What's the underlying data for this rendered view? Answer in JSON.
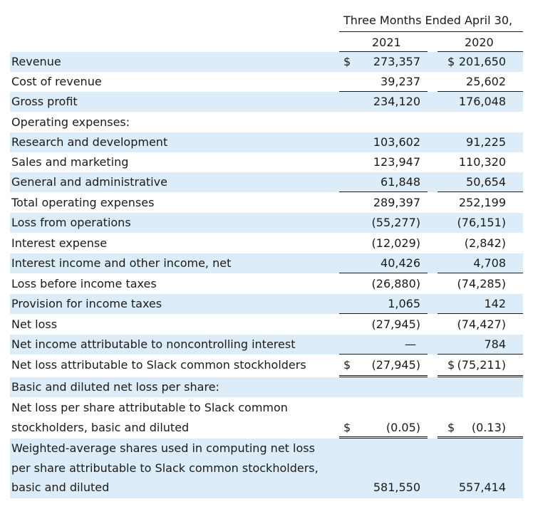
{
  "header": {
    "period": "Three Months Ended April 30,",
    "col1": "2021",
    "col2": "2020"
  },
  "rows": [
    {
      "label": "Revenue",
      "cur1": "$",
      "v1": "273,357",
      "cur2": "$",
      "v2": "201,650"
    },
    {
      "label": "Cost of revenue",
      "cur1": "",
      "v1": "39,237",
      "cur2": "",
      "v2": "25,602"
    },
    {
      "label": "Gross profit",
      "cur1": "",
      "v1": "234,120",
      "cur2": "",
      "v2": "176,048"
    },
    {
      "label": "Operating expenses:",
      "cur1": "",
      "v1": "",
      "cur2": "",
      "v2": ""
    },
    {
      "label": "Research and development",
      "cur1": "",
      "v1": "103,602",
      "cur2": "",
      "v2": "91,225"
    },
    {
      "label": "Sales and marketing",
      "cur1": "",
      "v1": "123,947",
      "cur2": "",
      "v2": "110,320"
    },
    {
      "label": "General and administrative",
      "cur1": "",
      "v1": "61,848",
      "cur2": "",
      "v2": "50,654"
    },
    {
      "label": "Total operating expenses",
      "cur1": "",
      "v1": "289,397",
      "cur2": "",
      "v2": "252,199"
    },
    {
      "label": "Loss from operations",
      "cur1": "",
      "v1": "(55,277)",
      "cur2": "",
      "v2": "(76,151)"
    },
    {
      "label": "Interest expense",
      "cur1": "",
      "v1": "(12,029)",
      "cur2": "",
      "v2": "(2,842)"
    },
    {
      "label": "Interest income and other income, net",
      "cur1": "",
      "v1": "40,426",
      "cur2": "",
      "v2": "4,708"
    },
    {
      "label": "Loss before income taxes",
      "cur1": "",
      "v1": "(26,880)",
      "cur2": "",
      "v2": "(74,285)"
    },
    {
      "label": "Provision for income taxes",
      "cur1": "",
      "v1": "1,065",
      "cur2": "",
      "v2": "142"
    },
    {
      "label": "Net loss",
      "cur1": "",
      "v1": "(27,945)",
      "cur2": "",
      "v2": "(74,427)"
    },
    {
      "label": "Net income attributable to noncontrolling interest",
      "cur1": "",
      "v1": "—",
      "cur2": "",
      "v2": "784"
    },
    {
      "label": "Net loss attributable to Slack common stockholders",
      "cur1": "$",
      "v1": "(27,945)",
      "cur2": "$",
      "v2": "(75,211)"
    },
    {
      "label": "Basic and diluted net loss per share:",
      "cur1": "",
      "v1": "",
      "cur2": "",
      "v2": ""
    },
    {
      "label1": "Net loss per share attributable to Slack common",
      "label2": "stockholders, basic and diluted",
      "cur1": "$",
      "v1": "(0.05)",
      "cur2": "$",
      "v2": "(0.13)"
    },
    {
      "label1": "Weighted-average shares used in computing net loss",
      "label2": "per share attributable to Slack common stockholders,",
      "label3": "basic and diluted",
      "cur1": "",
      "v1": "581,550",
      "cur2": "",
      "v2": "557,414"
    }
  ]
}
